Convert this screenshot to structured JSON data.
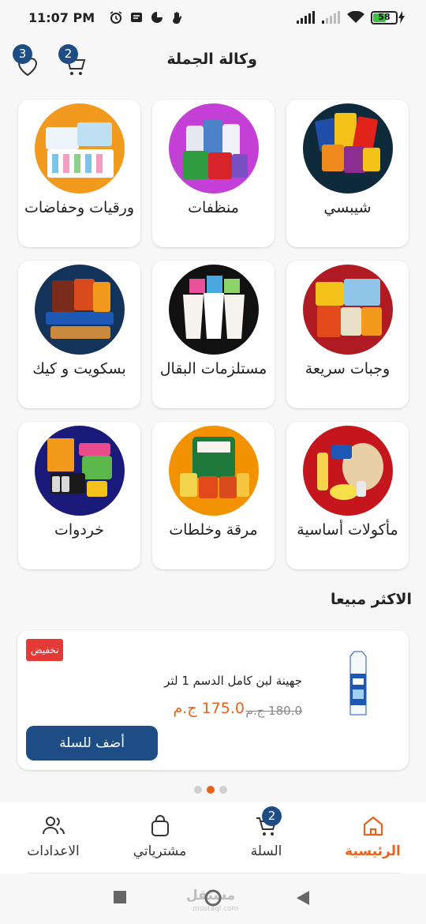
{
  "status_bar": {
    "time": "11:07 PM",
    "battery": "58"
  },
  "header": {
    "title": "وكالة الجملة",
    "favorites_count": "3",
    "cart_count": "2"
  },
  "categories": [
    {
      "label": "شيبسي",
      "color": "#0f2a3a"
    },
    {
      "label": "منظفات",
      "color": "#c43fd6"
    },
    {
      "label": "ورقيات وحفاضات",
      "color": "#f29a1d"
    },
    {
      "label": "وجبات سريعة",
      "color": "#b01a22"
    },
    {
      "label": "مستلزمات البقال",
      "color": "#111111"
    },
    {
      "label": "بسكويت و كيك",
      "color": "#14335a"
    },
    {
      "label": "مأكولات أساسية",
      "color": "#c4161c"
    },
    {
      "label": "مرقة وخلطات",
      "color": "#f39200"
    },
    {
      "label": "خردوات",
      "color": "#1a1a7a"
    }
  ],
  "best_sellers": {
    "title": "الاكثر مبيعا",
    "product": {
      "badge": "تخفيض",
      "name": "جهينة لبن كامل الدسم 1 لتر",
      "old_price": "180.0 ج.م",
      "new_price": "175.0 ج.م",
      "add_button": "أضف للسلة"
    }
  },
  "bottom_nav": {
    "home": "الرئيسية",
    "cart": "السلة",
    "cart_count": "2",
    "purchases": "مشترياتي",
    "settings": "الاعدادات"
  },
  "watermark": {
    "text": "مستقل",
    "sub": "mostaql.com"
  },
  "colors": {
    "accent": "#e8631c",
    "primary": "#1e4d86",
    "discount": "#e53935"
  }
}
